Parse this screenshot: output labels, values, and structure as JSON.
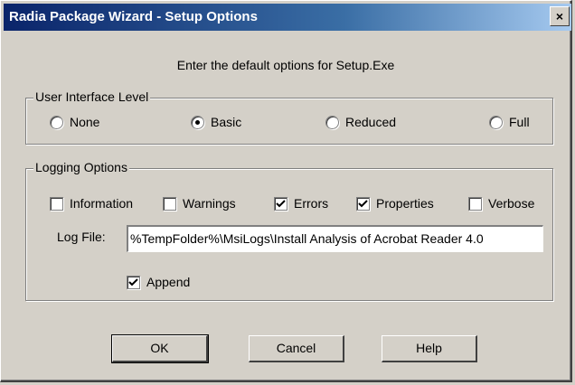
{
  "window": {
    "title": "Radia Package Wizard - Setup Options",
    "close_label": "×"
  },
  "intro_text": "Enter the default options for Setup.Exe",
  "ui_level": {
    "label": "User Interface Level",
    "options": [
      {
        "label": "None",
        "selected": false
      },
      {
        "label": "Basic",
        "selected": true
      },
      {
        "label": "Reduced",
        "selected": false
      },
      {
        "label": "Full",
        "selected": false
      }
    ]
  },
  "logging": {
    "label": "Logging Options",
    "options": [
      {
        "label": "Information",
        "checked": false
      },
      {
        "label": "Warnings",
        "checked": false
      },
      {
        "label": "Errors",
        "checked": true
      },
      {
        "label": "Properties",
        "checked": true
      },
      {
        "label": "Verbose",
        "checked": false
      }
    ],
    "log_file_label": "Log File:",
    "log_file_value": "%TempFolder%\\MsiLogs\\Install Analysis of Acrobat Reader 4.0",
    "append_label": "Append",
    "append_checked": true
  },
  "buttons": {
    "ok": "OK",
    "cancel": "Cancel",
    "help": "Help"
  }
}
